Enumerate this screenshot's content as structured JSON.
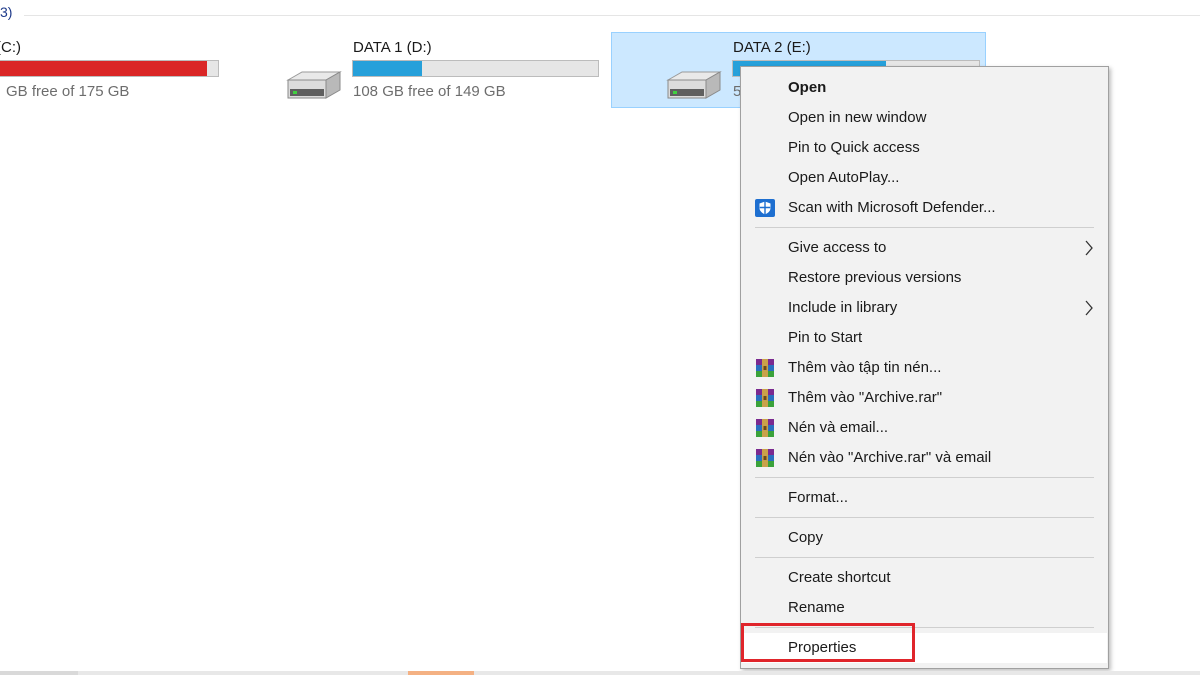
{
  "group_header": "3)",
  "drives": [
    {
      "name": "(C:)",
      "free_text": "GB free of 175 GB",
      "usage_fraction": 0.95,
      "bar_color": "#da2626"
    },
    {
      "name": "DATA 1 (D:)",
      "free_text": "108 GB free of 149 GB",
      "usage_fraction": 0.28,
      "bar_color": "#26a0da"
    },
    {
      "name": "DATA 2 (E:)",
      "free_text": "5",
      "usage_fraction": 0.62,
      "bar_color": "#26a0da"
    }
  ],
  "context_menu": {
    "items": [
      {
        "label": "Open",
        "bold": true
      },
      {
        "label": "Open in new window"
      },
      {
        "label": "Pin to Quick access"
      },
      {
        "label": "Open AutoPlay..."
      },
      {
        "label": "Scan with Microsoft Defender...",
        "icon": "defender-shield-icon"
      },
      {
        "label": "Give access to",
        "submenu": true
      },
      {
        "label": "Restore previous versions"
      },
      {
        "label": "Include in library",
        "submenu": true
      },
      {
        "label": "Pin to Start"
      },
      {
        "label": "Thêm vào tập tin nén...",
        "icon": "winrar-icon"
      },
      {
        "label": "Thêm vào \"Archive.rar\"",
        "icon": "winrar-icon"
      },
      {
        "label": "Nén và email...",
        "icon": "winrar-icon"
      },
      {
        "label": "Nén vào \"Archive.rar\" và email",
        "icon": "winrar-icon"
      },
      {
        "label": "Format..."
      },
      {
        "label": "Copy"
      },
      {
        "label": "Create shortcut"
      },
      {
        "label": "Rename"
      },
      {
        "label": "Properties"
      }
    ],
    "highlighted_item": "Properties"
  },
  "colors": {
    "selection_bg": "#cce8ff",
    "selection_border": "#99d1ff",
    "highlight_border": "#e0252b"
  }
}
